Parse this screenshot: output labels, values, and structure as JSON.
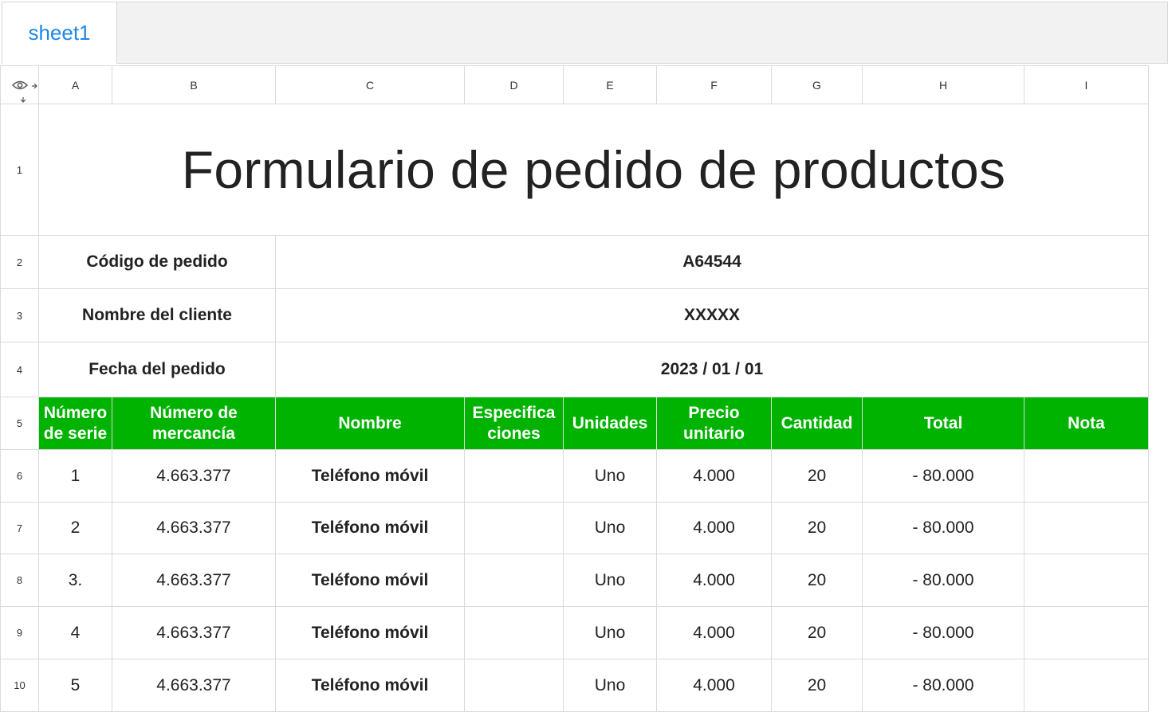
{
  "tabs": [
    {
      "label": "sheet1"
    }
  ],
  "columns": [
    "A",
    "B",
    "C",
    "D",
    "E",
    "F",
    "G",
    "H",
    "I"
  ],
  "rows": [
    "1",
    "2",
    "3",
    "4",
    "5",
    "6",
    "7",
    "8",
    "9",
    "10"
  ],
  "title": "Formulario de pedido de productos",
  "info": [
    {
      "label": "Código de pedido",
      "value": "A64544"
    },
    {
      "label": "Nombre del cliente",
      "value": "XXXXX"
    },
    {
      "label": "Fecha del pedido",
      "value": "2023 / 01 / 01"
    }
  ],
  "table_headers": [
    "Número de serie",
    "Número de mercancía",
    "Nombre",
    "Especifica ciones",
    "Unidades",
    "Precio unitario",
    "Cantidad",
    "Total",
    "Nota"
  ],
  "table_rows": [
    [
      "1",
      "4.663.377",
      "Teléfono móvil",
      "",
      "Uno",
      "4.000",
      "20",
      "- 80.000",
      ""
    ],
    [
      "2",
      "4.663.377",
      "Teléfono móvil",
      "",
      "Uno",
      "4.000",
      "20",
      "- 80.000",
      ""
    ],
    [
      "3.",
      "4.663.377",
      "Teléfono móvil",
      "",
      "Uno",
      "4.000",
      "20",
      "- 80.000",
      ""
    ],
    [
      "4",
      "4.663.377",
      "Teléfono móvil",
      "",
      "Uno",
      "4.000",
      "20",
      "- 80.000",
      ""
    ],
    [
      "5",
      "4.663.377",
      "Teléfono móvil",
      "",
      "Uno",
      "4.000",
      "20",
      "- 80.000",
      ""
    ]
  ],
  "colors": {
    "header_green": "#00b300",
    "tab_text": "#1e88e5"
  },
  "icons": [
    "eye-icon",
    "collapse-columns-icon",
    "collapse-rows-icon"
  ]
}
